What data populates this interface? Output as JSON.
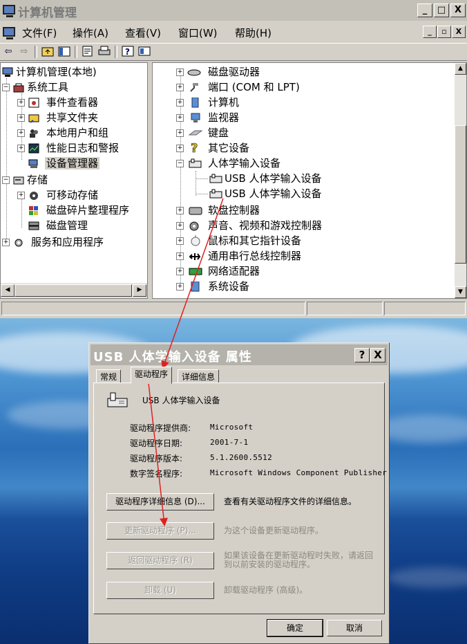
{
  "window": {
    "title": "计算机管理",
    "caption_buttons": [
      "_",
      "□",
      "X"
    ],
    "child_caption_buttons": [
      "_",
      "▫",
      "X"
    ]
  },
  "menubar": [
    "文件(F)",
    "操作(A)",
    "查看(V)",
    "窗口(W)",
    "帮助(H)"
  ],
  "toolbar_icons": [
    "back-arrow-icon",
    "forward-arrow-icon",
    "up-folder-icon",
    "show-hide-tree-icon",
    "properties-icon",
    "print-icon",
    "help-icon",
    "console-icon"
  ],
  "tree": {
    "root": "计算机管理(本地)",
    "system_tools": "系统工具",
    "event_viewer": "事件查看器",
    "shared_folders": "共享文件夹",
    "local_users": "本地用户和组",
    "perf_logs": "性能日志和警报",
    "device_manager": "设备管理器",
    "storage": "存储",
    "removable_storage": "可移动存储",
    "defrag": "磁盘碎片整理程序",
    "disk_mgmt": "磁盘管理",
    "services": "服务和应用程序"
  },
  "devices": {
    "disk_drives": "磁盘驱动器",
    "ports": "端口 (COM 和 LPT)",
    "computer": "计算机",
    "monitors": "监视器",
    "keyboards": "键盘",
    "other": "其它设备",
    "hid": "人体学输入设备",
    "hid_child1": "USB 人体学输入设备",
    "hid_child2": "USB 人体学输入设备",
    "floppy": "软盘控制器",
    "sound": "声音、视频和游戏控制器",
    "mice": "鼠标和其它指针设备",
    "usb": "通用串行总线控制器",
    "network": "网络适配器",
    "system": "系统设备"
  },
  "dialog": {
    "title": "USB 人体学输入设备 属性",
    "help_btn": "?",
    "close_btn": "X",
    "tabs": [
      "常规",
      "驱动程序",
      "详细信息"
    ],
    "device_name": "USB 人体学输入设备",
    "fields": [
      {
        "label": "驱动程序提供商:",
        "value": "Microsoft"
      },
      {
        "label": "驱动程序日期:",
        "value": "2001-7-1"
      },
      {
        "label": "驱动程序版本:",
        "value": "5.1.2600.5512"
      },
      {
        "label": "数字签名程序:",
        "value": "Microsoft Windows Component Publisher"
      }
    ],
    "actions": [
      {
        "button": "驱动程序详细信息 (D)...",
        "desc": "查看有关驱动程序文件的详细信息。",
        "enabled": true
      },
      {
        "button": "更新驱动程序 (P)...",
        "desc": "为这个设备更新驱动程序。",
        "enabled": false
      },
      {
        "button": "返回驱动程序 (R)",
        "desc": "如果该设备在更新驱动程时失败，请返回到以前安装的驱动程序。",
        "enabled": false
      },
      {
        "button": "卸载 (U)",
        "desc": "卸载驱动程序 (高级)。",
        "enabled": false
      }
    ],
    "ok": "确定",
    "cancel": "取消"
  },
  "colors": {
    "annotation_arrow": "#e02020",
    "window_face": "#d4d0c8",
    "desktop_blue": "#2a6fb8"
  }
}
